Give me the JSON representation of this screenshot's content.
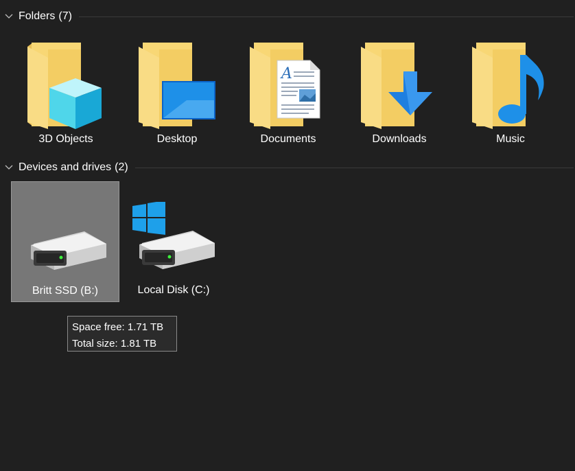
{
  "folders_group": {
    "title": "Folders",
    "count": "(7)",
    "items": [
      {
        "label": "3D Objects",
        "icon": "3d-objects-folder-icon"
      },
      {
        "label": "Desktop",
        "icon": "desktop-folder-icon"
      },
      {
        "label": "Documents",
        "icon": "documents-folder-icon"
      },
      {
        "label": "Downloads",
        "icon": "downloads-folder-icon"
      },
      {
        "label": "Music",
        "icon": "music-folder-icon"
      }
    ]
  },
  "drives_group": {
    "title": "Devices and drives",
    "count": "(2)",
    "items": [
      {
        "label": "Britt SSD (B:)",
        "icon": "hard-drive-icon",
        "selected": true
      },
      {
        "label": "Local Disk (C:)",
        "icon": "windows-system-drive-icon",
        "selected": false
      }
    ]
  },
  "tooltip": {
    "space_free": "Space free: 1.71 TB",
    "total_size": "Total size: 1.81 TB"
  },
  "colors": {
    "background": "#202020",
    "selection": "#777777",
    "folder": "#f8d775",
    "accent_blue": "#1e90e8"
  }
}
